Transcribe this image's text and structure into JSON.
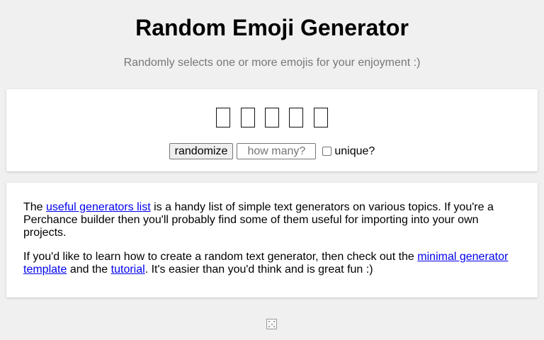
{
  "header": {
    "title": "Random Emoji Generator",
    "subtitle": "Randomly selects one or more emojis for your enjoyment :)"
  },
  "output": {
    "emojis": [
      "missing-glyph",
      "missing-glyph",
      "missing-glyph",
      "missing-glyph",
      "missing-glyph"
    ]
  },
  "controls": {
    "randomize_label": "randomize",
    "count_placeholder": "how many?",
    "count_value": "",
    "unique_label": "unique?",
    "unique_checked": false
  },
  "info": {
    "p1_before": "The ",
    "p1_link": "useful generators list",
    "p1_after": " is a handy list of simple text generators on various topics. If you're a Perchance builder then you'll probably find some of them useful for importing into your own projects.",
    "p2_before": "If you'd like to learn how to create a random text generator, then check out the ",
    "p2_link1": "minimal generator template",
    "p2_mid": " and the ",
    "p2_link2": "tutorial",
    "p2_after": ". It's easier than you'd think and is great fun :)"
  },
  "footer": {
    "icon": "dice-icon"
  }
}
